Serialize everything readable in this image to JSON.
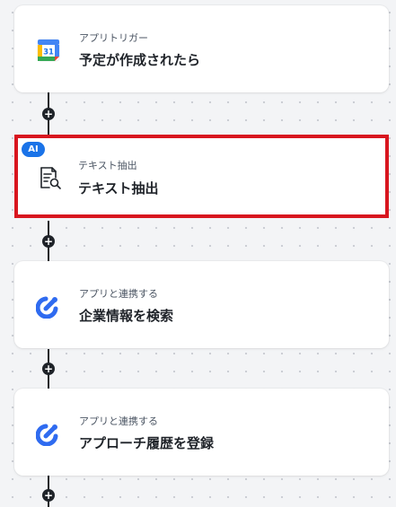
{
  "steps": [
    {
      "kicker": "アプリトリガー",
      "title": "予定が作成されたら",
      "icon": "google-calendar-icon",
      "icon_text": "31"
    },
    {
      "kicker": "テキスト抽出",
      "title": "テキスト抽出",
      "icon": "document-search-icon",
      "badge": "AI",
      "selected": true
    },
    {
      "kicker": "アプリと連携する",
      "title": "企業情報を検索",
      "icon": "app-link-icon"
    },
    {
      "kicker": "アプリと連携する",
      "title": "アプローチ履歴を登録",
      "icon": "app-link-icon"
    }
  ],
  "colors": {
    "background": "#f3f4f6",
    "connector": "#1f2329",
    "selection_border": "#d8161f",
    "ai_badge": "#1a73e8",
    "link_icon": "#2f6bf0"
  }
}
